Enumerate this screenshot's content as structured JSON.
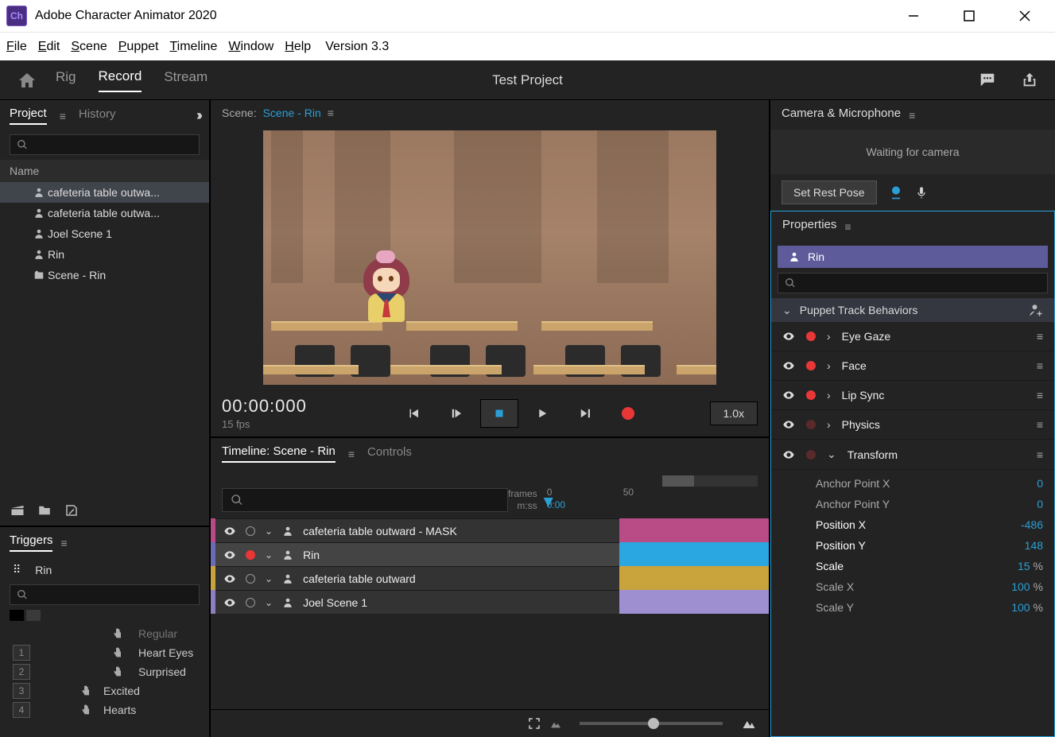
{
  "window": {
    "app_badge": "Ch",
    "title": "Adobe Character Animator 2020"
  },
  "menu": {
    "file": "File",
    "edit": "Edit",
    "scene": "Scene",
    "puppet": "Puppet",
    "timeline": "Timeline",
    "window": "Window",
    "help": "Help",
    "version": "Version 3.3"
  },
  "topnav": {
    "rig": "Rig",
    "record": "Record",
    "stream": "Stream"
  },
  "project_title": "Test Project",
  "project_panel": {
    "tab_project": "Project",
    "tab_history": "History",
    "name_header": "Name",
    "items": [
      "cafeteria table outwa...",
      "cafeteria table outwa...",
      "Joel Scene 1",
      "Rin",
      "Scene - Rin"
    ]
  },
  "triggers": {
    "title": "Triggers",
    "puppet": "Rin",
    "rows": {
      "regular": "Regular",
      "heart_eyes": "Heart Eyes",
      "surprised": "Surprised",
      "excited": "Excited",
      "hearts": "Hearts",
      "k1": "1",
      "k2": "2",
      "k3": "3",
      "k4": "4"
    }
  },
  "scene": {
    "label": "Scene:",
    "name": "Scene - Rin"
  },
  "transport": {
    "timecode": "00:00:00",
    "frame": "0",
    "fps": "15 fps",
    "speed": "1.0x"
  },
  "timeline": {
    "tab_timeline": "Timeline: Scene - Rin",
    "tab_controls": "Controls",
    "frames_label": "frames",
    "mss_label": "m:ss",
    "tick0": "0",
    "tick50": "50",
    "time0": "0:00",
    "tracks": [
      {
        "label": "cafeteria table outward - MASK",
        "color": "#b94b86",
        "clip": "#b94b86",
        "armed": false
      },
      {
        "label": "Rin",
        "color": "#6d6bb5",
        "clip": "#2aa7e0",
        "armed": true
      },
      {
        "label": "cafeteria table outward",
        "color": "#c9a33b",
        "clip": "#c9a33b",
        "armed": false
      },
      {
        "label": "Joel Scene 1",
        "color": "#8e7fc2",
        "clip": "#9d8fd0",
        "armed": false
      }
    ]
  },
  "cam": {
    "title": "Camera & Microphone",
    "waiting": "Waiting for camera",
    "rest": "Set Rest Pose"
  },
  "properties": {
    "title": "Properties",
    "selected": "Rin",
    "behaviors_header": "Puppet Track Behaviors",
    "behaviors": [
      {
        "name": "Eye Gaze",
        "armed": true
      },
      {
        "name": "Face",
        "armed": true
      },
      {
        "name": "Lip Sync",
        "armed": true
      },
      {
        "name": "Physics",
        "armed": false
      }
    ],
    "transform": {
      "header": "Transform",
      "rows": [
        {
          "label": "Anchor Point X",
          "val": "0",
          "unit": "",
          "sel": false
        },
        {
          "label": "Anchor Point Y",
          "val": "0",
          "unit": "",
          "sel": false
        },
        {
          "label": "Position X",
          "val": "-486",
          "unit": "",
          "sel": true
        },
        {
          "label": "Position Y",
          "val": "148",
          "unit": "",
          "sel": true
        },
        {
          "label": "Scale",
          "val": "15",
          "unit": "%",
          "sel": true
        },
        {
          "label": "Scale X",
          "val": "100",
          "unit": "%",
          "sel": false
        },
        {
          "label": "Scale Y",
          "val": "100",
          "unit": "%",
          "sel": false
        }
      ]
    }
  }
}
